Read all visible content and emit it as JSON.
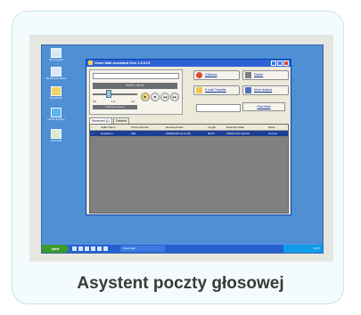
{
  "desktop": {
    "icons": [
      {
        "label": "My Computer",
        "icon": "computer-icon"
      },
      {
        "label": "My Network Places",
        "icon": "network-icon"
      },
      {
        "label": "Recycle Bin",
        "icon": "recycle-bin-icon"
      },
      {
        "label": "Internet Explorer",
        "icon": "internet-explorer-icon"
      },
      {
        "label": "Voice Mail",
        "icon": "voicemail-icon"
      }
    ],
    "taskbar": {
      "start_label": "start",
      "task_label": "Voice Mail",
      "clock": "10:47"
    }
  },
  "window": {
    "title": "Voice Mail Assistant Gen 1.0.0.61"
  },
  "player": {
    "time_display": "00:00 / 00:00",
    "speed_marks": [
      "0.5",
      "1.0",
      "2.0"
    ],
    "speed_label": "Playback speed",
    "buttons": {
      "play": "▶",
      "stop": "■",
      "rewind": "◀◀",
      "forward": "▶▶"
    }
  },
  "actions": {
    "callback": "Callback",
    "delete": "Delete",
    "email_transfer": "E-mail Transfer",
    "more_actions": "More Actions",
    "find_next": "Find Next",
    "find_value": ""
  },
  "tabs": [
    "Received (1)",
    "Deleted"
  ],
  "table": {
    "columns": [
      "!",
      "Caller Name",
      "Phone Number",
      "Received Date",
      "Length",
      "Retention Date",
      "Mode"
    ],
    "rows": [
      [
        "!",
        "Nowaka K",
        "298",
        "2009/01/06 10:21:08",
        "00:03",
        "2009/01/10 0:00:00",
        "Normal"
      ]
    ]
  },
  "caption": "Asystent poczty głosowej",
  "colors": {
    "card_border": "#c8e4ef",
    "desktop_blue": "#4f8fd4",
    "titlebar_blue": "#2e63d6",
    "selected_row": "#1c3f94",
    "grid_gray": "#808080",
    "caption_text": "#3a3a3a"
  }
}
